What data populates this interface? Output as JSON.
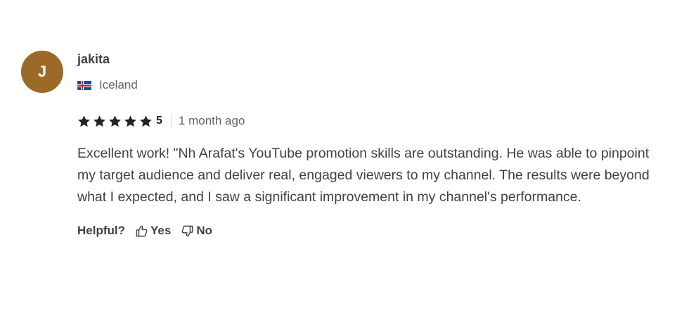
{
  "review": {
    "avatar_initial": "J",
    "avatar_color": "#9c6a26",
    "username": "jakita",
    "country": "Iceland",
    "country_flag_icon": "iceland-flag-icon",
    "rating": {
      "stars": 5,
      "max": 5,
      "score_label": "5"
    },
    "time_ago": "1 month ago",
    "text": "Excellent work! \"Nh Arafat's YouTube promotion skills are outstanding. He was able to pinpoint my target audience and deliver real, engaged viewers to my channel. The results were beyond what I expected, and I saw a significant improvement in my channel's performance.",
    "helpful": {
      "label": "Helpful?",
      "yes_label": "Yes",
      "yes_icon": "thumbs-up-icon",
      "no_label": "No",
      "no_icon": "thumbs-down-icon"
    }
  }
}
